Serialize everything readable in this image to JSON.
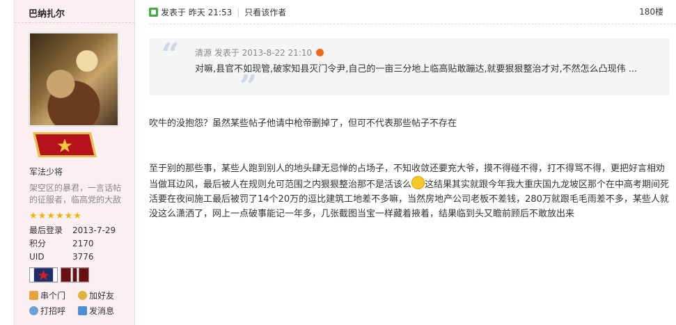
{
  "author": {
    "name": "巴纳扎尔",
    "rank": "军法少将",
    "signature": "架空区的暴君，一言话帖的征服者，临高党的大敌",
    "stars": "★★★★★★",
    "info": [
      {
        "label": "最后登录",
        "value": "2013-7-29"
      },
      {
        "label": "积分",
        "value": "2170"
      },
      {
        "label": "UID",
        "value": "3776"
      }
    ],
    "actions": [
      {
        "label": "串个门",
        "icon": "home-icon"
      },
      {
        "label": "加好友",
        "icon": "add-friend-icon"
      },
      {
        "label": "打招呼",
        "icon": "greet-icon"
      },
      {
        "label": "发消息",
        "icon": "message-icon"
      }
    ]
  },
  "post": {
    "posted_label": "发表于 昨天 21:53",
    "view_author": "只看该作者",
    "floor": "180楼",
    "quote": {
      "meta": "清源 发表于 2013-8-22 21:10",
      "text": "对嘛,县官不如现管,破家知县灭门令尹,自己的一亩三分地上临高贴敢蹦达,就要狠狠整治才对,不然怎么凸现伟 ..."
    },
    "paragraph1": "吹牛的没抱怨？虽然某些帖子他请中枪帝删掉了，但可不代表那些帖子不存在",
    "paragraph2_a": "至于别的那些事，某些人跑到别人的地头肆无忌惮的占场子，不知收敛还要充大爷，摸不得碰不得，打不得骂不得，更把好言相劝当做耳边风，最后被人在规则允可范围之内狠狠整治那不是活该么",
    "paragraph2_b": "这结果其实就跟今年我大重庆国九龙坡区那个在中高考期间死活要在夜间施工最后被罚了14个20万的逗比建筑工地差不多嘛，当然房地产公司老板不差钱，280万就跟毛毛雨差不多，某些人就没这么潇洒了，网上一点破事能记一年多，几张截图当宝一样藏着掖着，结果临到头又瞻前顾后不敢放出来"
  },
  "colors": {
    "sidebar_bg": "#fbeff2",
    "quote_bg": "#f5f5f5",
    "quote_mark": "#c9d7e6",
    "star": "#f0b400"
  }
}
